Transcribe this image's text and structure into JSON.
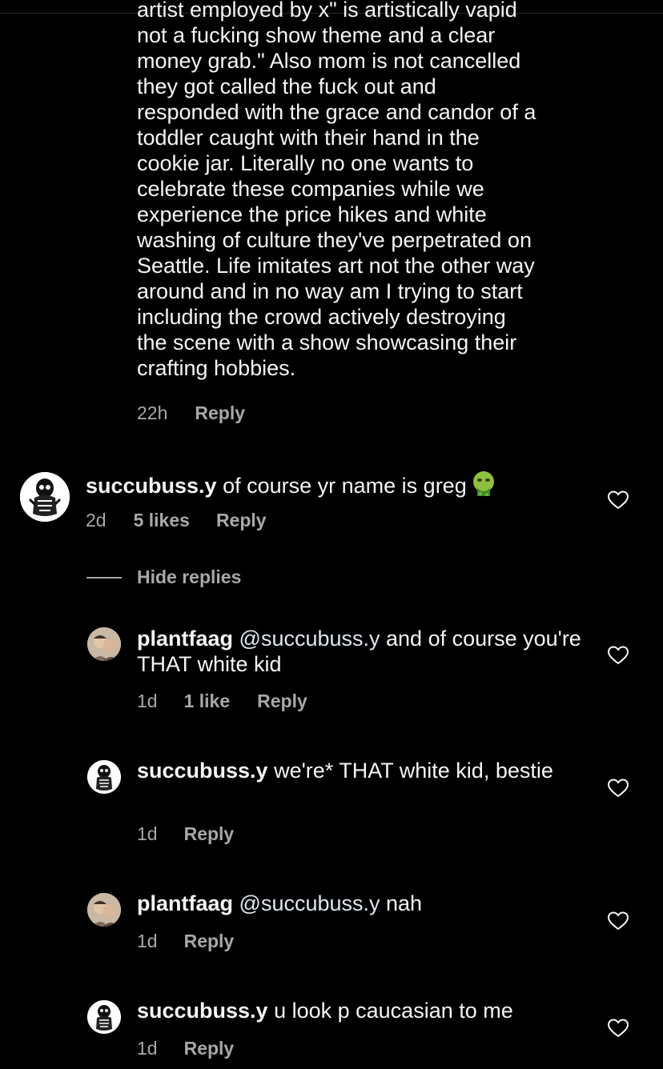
{
  "continued_comment": {
    "text": "artist employed by x\" is artistically vapid\nnot a fucking show theme and a clear\nmoney grab.\" Also mom is not cancelled\nthey got called the fuck out and\nresponded with the grace and candor of a\ntoddler caught with their hand in the\ncookie jar. Literally no one wants to\ncelebrate these companies while we\nexperience the price hikes and white\nwashing of culture they've perpetrated on\nSeattle. Life imitates art not the other way\naround and in no way am I trying to start\nincluding the crowd actively destroying\nthe scene with a show showcasing their\ncrafting hobbies.",
    "time": "22h",
    "reply_label": "Reply"
  },
  "comments": [
    {
      "username": "succubuss.y",
      "text": " of course yr name is greg",
      "emoji": "nauseated-face-icon",
      "time": "2d",
      "likes": "5 likes",
      "reply_label": "Reply"
    }
  ],
  "hide_replies_label": "Hide replies",
  "replies": [
    {
      "username": "plantfaag",
      "mention": "@succubuss.y",
      "text": " and of course you're THAT white kid",
      "time": "1d",
      "likes": "1 like",
      "reply_label": "Reply"
    },
    {
      "username": "succubuss.y",
      "mention": "",
      "text": " we're* THAT white kid, bestie",
      "time": "1d",
      "likes": "",
      "reply_label": "Reply"
    },
    {
      "username": "plantfaag",
      "mention": "@succubuss.y",
      "text": " nah",
      "time": "1d",
      "likes": "",
      "reply_label": "Reply"
    },
    {
      "username": "succubuss.y",
      "mention": "",
      "text": " u look p caucasian to me",
      "time": "1d",
      "likes": "",
      "reply_label": "Reply"
    }
  ],
  "icons": {
    "like": "heart-outline-icon",
    "avatar_succubuss": "skull-figure-avatar",
    "avatar_plantfaag": "photo-avatar"
  },
  "colors": {
    "background": "#000000",
    "primary_text": "#f5f5f5",
    "secondary_text": "#a8a8a8"
  }
}
